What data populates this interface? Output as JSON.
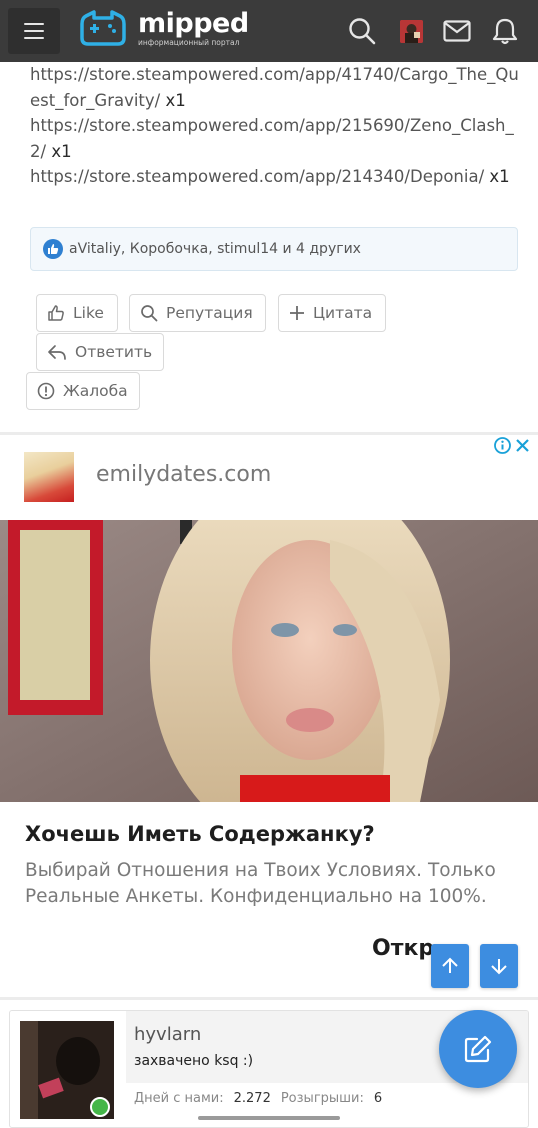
{
  "header": {
    "logo_name": "mipped",
    "logo_sub": "информационный портал"
  },
  "post": {
    "lines": [
      {
        "url": "https://store.steampowered.com/app/41740/Cargo_The_Quest_for_Gravity/",
        "count": "x1"
      },
      {
        "url": "https://store.steampowered.com/app/215690/Zeno_Clash_2/",
        "count": "x1"
      },
      {
        "url": "https://store.steampowered.com/app/214340/Deponia/",
        "count": "x1"
      }
    ],
    "likes_text": "aVitaliy, Коробочка, stimul14 и 4 других"
  },
  "actions": {
    "like": "Like",
    "reputation": "Репутация",
    "quote": "Цитата",
    "reply": "Ответить",
    "report": "Жалоба"
  },
  "ad": {
    "domain": "emilydates.com",
    "title": "Хочешь Иметь Содержанку?",
    "description": "Выбирай Отношения на Твоих Условиях. Только Реальные Анкеты. Конфиденциально на 100%.",
    "open_label": "Откр"
  },
  "next_post": {
    "username": "hyvlarn",
    "user_title": "захвачено ksq :)",
    "days_label": "Дней с нами:",
    "days_value": "2.272",
    "giveaways_label": "Розыгрыши:",
    "giveaways_value": "6"
  },
  "colors": {
    "header_bg": "#3b3b3b",
    "accent": "#3d8de0",
    "logo_cyan": "#2fb0e6"
  }
}
